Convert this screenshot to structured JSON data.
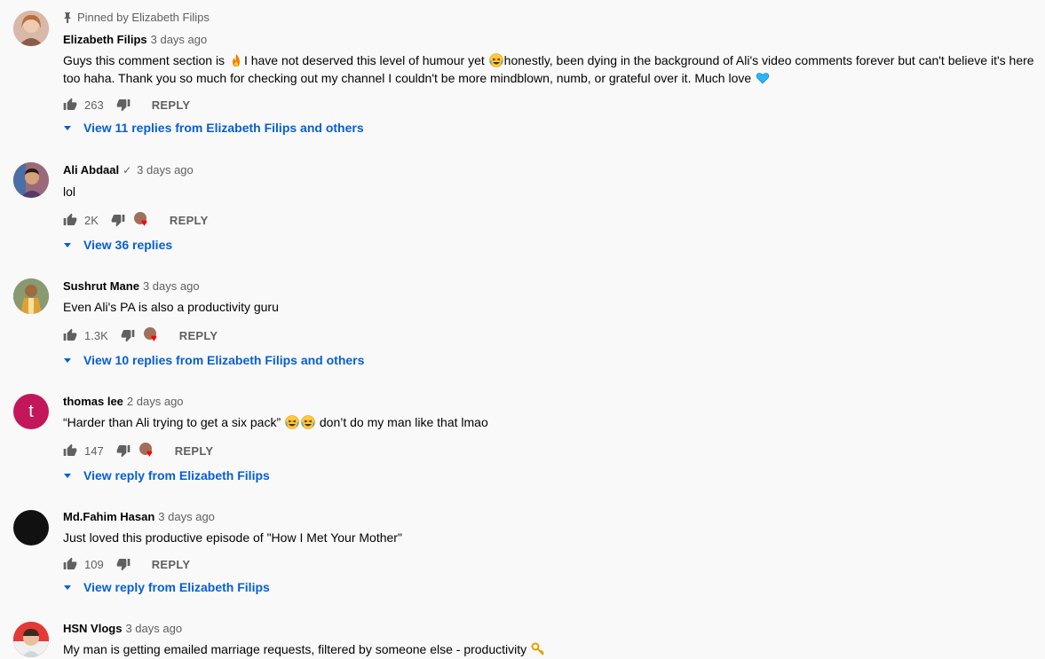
{
  "comments": [
    {
      "pinned_label": "Pinned by Elizabeth Filips",
      "author": "Elizabeth Filips",
      "verified": false,
      "time": "3 days ago",
      "text_parts": [
        "Guys this comment section is ",
        "I have not deserved this level of humour yet ",
        "honestly, been dying in the background of Ali's video comments forever but can't believe it's here too haha. Thank you so much for checking out my channel I couldn't be more mindblown, numb, or grateful over it. Much love "
      ],
      "emojis": [
        "fire-emoji",
        "laughing-emoji",
        "blue-heart-emoji"
      ],
      "likes": "263",
      "hearted": false,
      "reply_label": "REPLY",
      "view_replies": "View 11 replies from Elizabeth Filips and others",
      "avatar_color": "#c89a86"
    },
    {
      "author": "Ali Abdaal",
      "verified": true,
      "verified_mark": "✓",
      "time": "3 days ago",
      "text": "lol",
      "likes": "2K",
      "hearted": true,
      "reply_label": "REPLY",
      "view_replies": "View 36 replies",
      "avatar_color": "#b0788a"
    },
    {
      "author": "Sushrut Mane",
      "verified": false,
      "time": "3 days ago",
      "text": "Even Ali's PA is also a productivity guru",
      "likes": "1.3K",
      "hearted": true,
      "reply_label": "REPLY",
      "view_replies": "View 10 replies from Elizabeth Filips and others",
      "avatar_color": "#6f7a5a"
    },
    {
      "author": "thomas lee",
      "verified": false,
      "time": "2 days ago",
      "text_parts": [
        "“Harder than Ali trying to get a six pack” ",
        " don’t do my man like that lmao"
      ],
      "emojis": [
        "laughing-emoji",
        "laughing-emoji"
      ],
      "likes": "147",
      "hearted": true,
      "reply_label": "REPLY",
      "view_replies": "View reply from Elizabeth Filips",
      "avatar_color": "#c2185b",
      "avatar_letter": "t"
    },
    {
      "author": "Md.Fahim Hasan",
      "verified": false,
      "time": "3 days ago",
      "text": "Just loved this productive episode of \"How I Met Your Mother\"",
      "likes": "109",
      "hearted": false,
      "reply_label": "REPLY",
      "view_replies": "View reply from Elizabeth Filips",
      "avatar_color": "#111111"
    },
    {
      "author": "HSN Vlogs",
      "verified": false,
      "time": "3 days ago",
      "text_parts": [
        "My man is getting emailed marriage requests, filtered by someone else - productivity "
      ],
      "emojis": [
        "key-emoji"
      ],
      "avatar_color": "#e53935"
    }
  ]
}
